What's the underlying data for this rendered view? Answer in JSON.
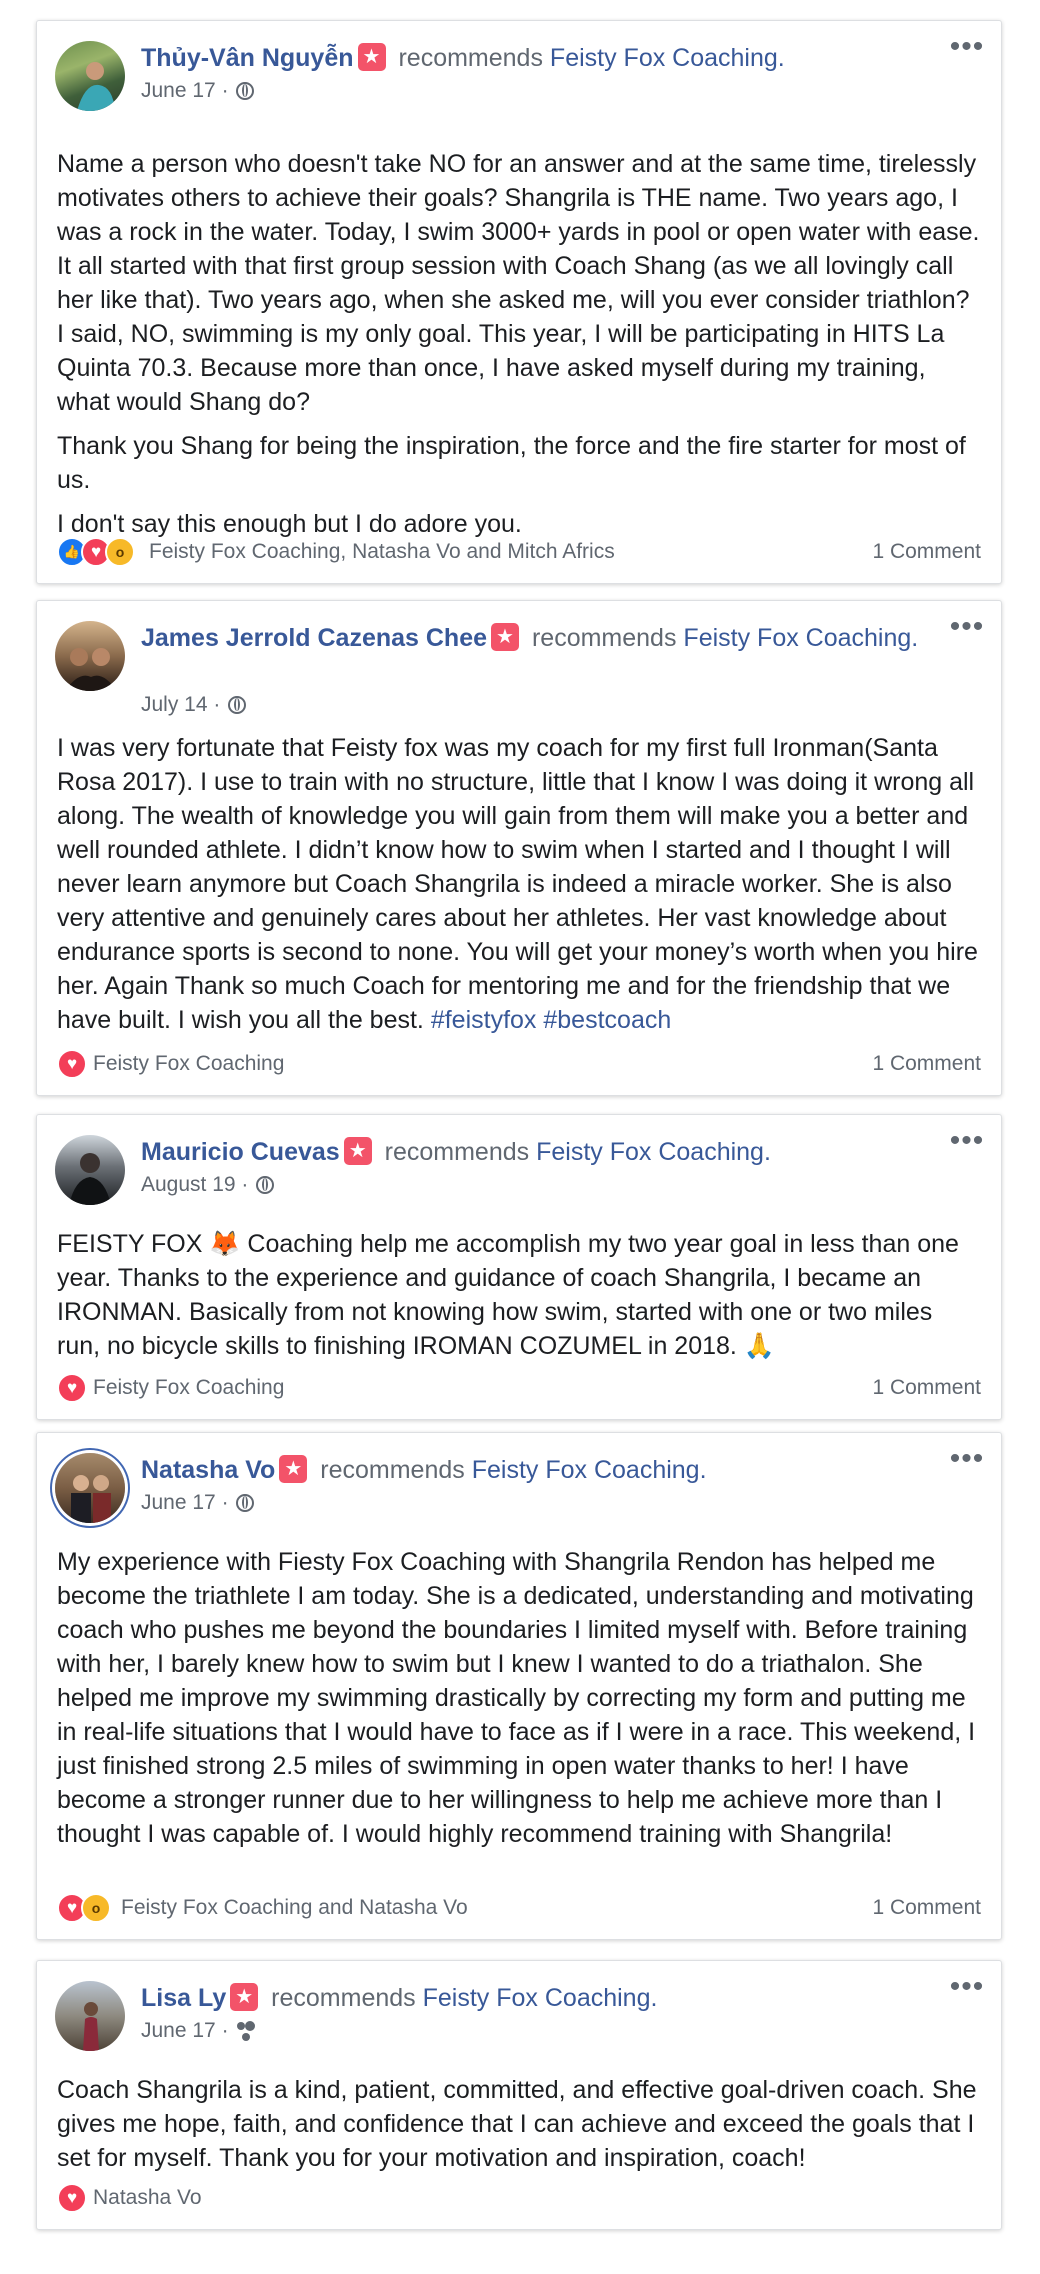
{
  "recommends_text": "recommends",
  "page_name": "Feisty Fox Coaching.",
  "posts": [
    {
      "name": "Thủy-Vân Nguyễn",
      "date": "June 17 ·",
      "paragraphs": [
        "Name a person who doesn't take NO for an answer and at the same time, tirelessly motivates others to achieve their goals? Shangrila is THE name. Two years ago, I was a rock in the water. Today, I swim 3000+ yards in pool or open water with ease. It all started with that first group session with Coach Shang (as we all lovingly call her like that). Two years ago, when she asked me, will you ever consider triathlon? I said, NO, swimming is my only goal. This year, I will be participating in HITS La Quinta 70.3. Because more than once, I have asked myself during my training, what would Shang do?",
        "Thank you Shang for being the inspiration, the force and the fire starter for most of us.",
        "I don't say this enough but I do adore you."
      ],
      "reactions": [
        "like",
        "love",
        "wow"
      ],
      "reactors": "Feisty Fox Coaching, Natasha Vo and Mitch Africs",
      "comments": "1 Comment",
      "privacy_icon": "globe-icon"
    },
    {
      "name": "James Jerrold Cazenas Chee",
      "date": "July 14 ·",
      "paragraphs": [
        "I was very fortunate that Feisty fox was my coach for my first full Ironman(Santa Rosa 2017). I use to train with no structure, little that I know I was doing it wrong all along. The wealth of knowledge you will gain from them will make you a better and well rounded athlete. I didn’t know how to swim when I started and I thought I will never learn anymore but Coach Shangrila is indeed a miracle worker. She is also very attentive and genuinely cares about her athletes. Her vast knowledge about endurance sports is second to none. You will get your money’s worth when you hire her. Again Thank so much Coach for mentoring me and for the friendship that we have built. I wish you all the best."
      ],
      "hashtags": "#feistyfox #bestcoach",
      "reactions": [
        "love"
      ],
      "reactors": "Feisty Fox Coaching",
      "comments": "1 Comment",
      "privacy_icon": "globe-icon"
    },
    {
      "name": "Mauricio Cuevas",
      "date": "August 19 ·",
      "paragraphs": [
        "FEISTY FOX 🦊 Coaching help me accomplish my two year goal in less than one year. Thanks to the experience and guidance of coach Shangrila, I became an IRONMAN. Basically from not knowing how swim, started with one or two miles run, no bicycle skills to finishing IROMAN COZUMEL in 2018. 🙏"
      ],
      "reactions": [
        "love"
      ],
      "reactors": "Feisty Fox Coaching",
      "comments": "1 Comment",
      "privacy_icon": "globe-icon"
    },
    {
      "name": "Natasha Vo",
      "date": "June 17 ·",
      "paragraphs": [
        "My experience with Fiesty Fox Coaching with Shangrila Rendon has helped me become the triathlete I am today. She is a dedicated, understanding and motivating coach who pushes me beyond the boundaries I limited myself with. Before training with her, I barely knew how to swim but I knew I wanted to do a triathalon. She helped me improve my swimming drastically by correcting my form and putting me in real-life situations that I would have to face as if I were in a race. This weekend, I just finished strong 2.5 miles of swimming in open water thanks to her! I have become a stronger runner due to her willingness to help me achieve more than I thought I was capable of. I would highly recommend training with Shangrila!"
      ],
      "reactions": [
        "love",
        "wow"
      ],
      "reactors": "Feisty Fox Coaching and Natasha Vo",
      "comments": "1 Comment",
      "privacy_icon": "globe-icon"
    },
    {
      "name": "Lisa Ly",
      "date": "June 17 ·",
      "paragraphs": [
        "Coach Shangrila is a kind, patient, committed, and effective goal-driven coach. She gives me hope, faith, and confidence that I can achieve and exceed the goals that I set for myself. Thank you for your motivation and inspiration, coach!"
      ],
      "reactions": [
        "love"
      ],
      "reactors": "Natasha Vo",
      "comments": "",
      "privacy_icon": "friends-icon"
    }
  ],
  "more_icon": "more-options-icon",
  "recommend_icon": "recommend-star-icon"
}
